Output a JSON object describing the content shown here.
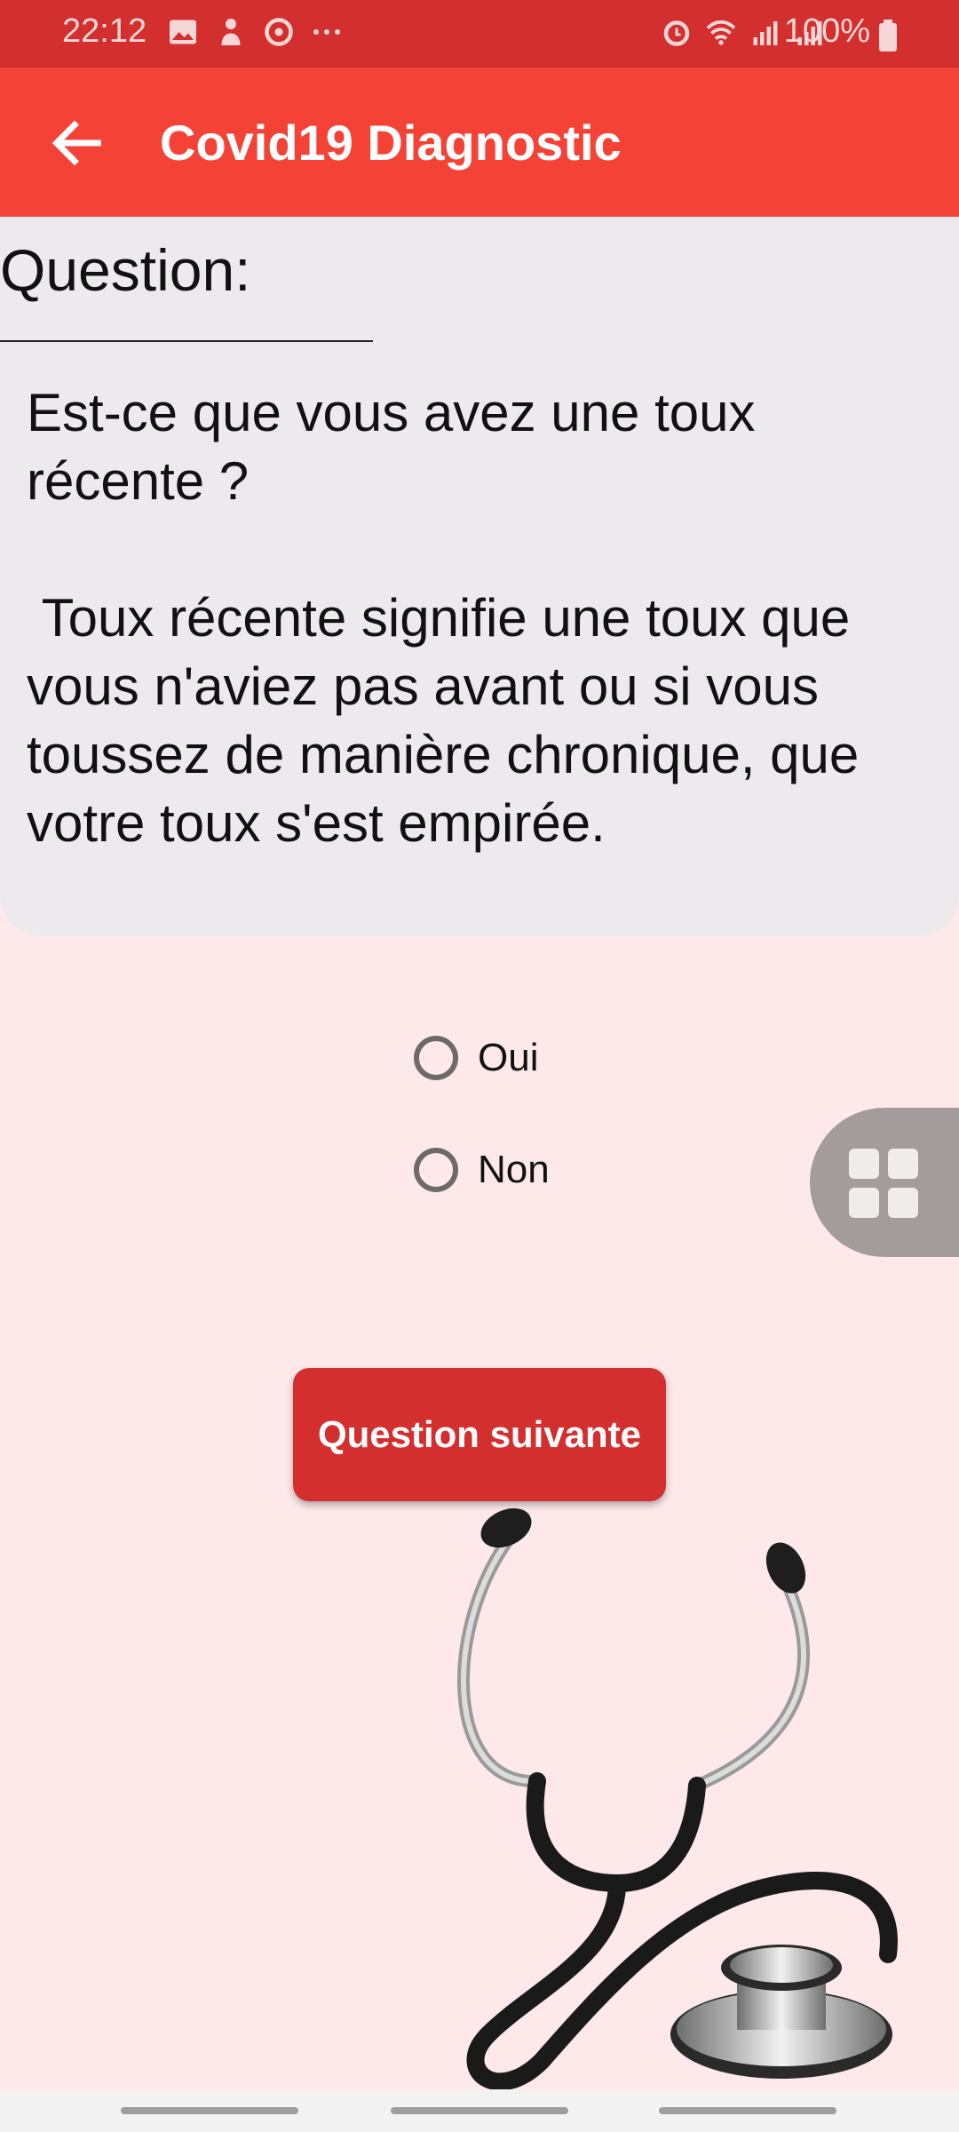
{
  "status_bar": {
    "time": "22:12",
    "battery_percent": "100%",
    "left_icons": [
      "image-icon",
      "person-notification-icon",
      "sync-icon",
      "more-dots-icon"
    ],
    "right_icons": [
      "alarm-icon",
      "wifi-icon",
      "signal-icon",
      "signal-icon-2",
      "battery-icon"
    ]
  },
  "app_bar": {
    "title": "Covid19 Diagnostic",
    "back_icon": "arrow-left-icon",
    "background": "#f44336"
  },
  "question": {
    "label": "Question:",
    "text": "Est-ce que vous avez une toux récente ?\n\n Toux récente signifie une toux que vous n'aviez pas avant ou si vous toussez de manière chronique, que votre toux s'est empirée."
  },
  "answers": {
    "options": [
      "Oui",
      "Non"
    ],
    "selected": null
  },
  "next_button": {
    "label": "Question suivante",
    "color": "#d32f2f"
  },
  "floating_button": {
    "icon": "grid-apps-icon"
  },
  "illustration": {
    "icon": "stethoscope-icon"
  },
  "colors": {
    "status_bar": "#d32f2f",
    "page_background": "#fde8ea",
    "card_background": "#edeaee"
  }
}
